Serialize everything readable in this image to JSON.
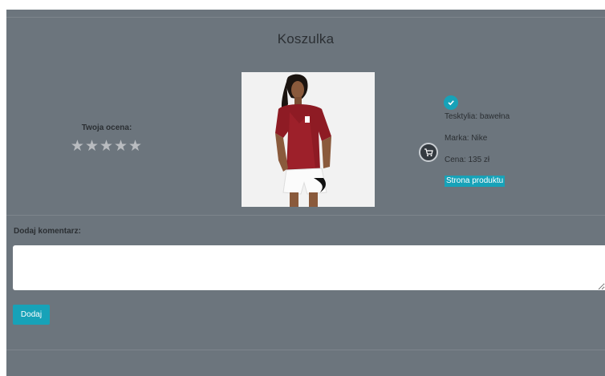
{
  "product": {
    "title": "Koszulka",
    "rating_label": "Twoja ocena:",
    "stars": "★★★★★",
    "material": "Tesktylia: bawełna",
    "brand": "Marka: Nike",
    "price": "Cena: 135 zł",
    "link_label": "Strona produktu"
  },
  "comment": {
    "label": "Dodaj komentarz:",
    "value": "",
    "submit_label": "Dodaj"
  },
  "icons": {
    "cart": "cart-icon",
    "check": "check-circle-icon",
    "image": "product-image"
  },
  "colors": {
    "background": "#6c757d",
    "accent": "#17a2b8",
    "text": "#2b2f33",
    "cart_button": "#343a40"
  }
}
